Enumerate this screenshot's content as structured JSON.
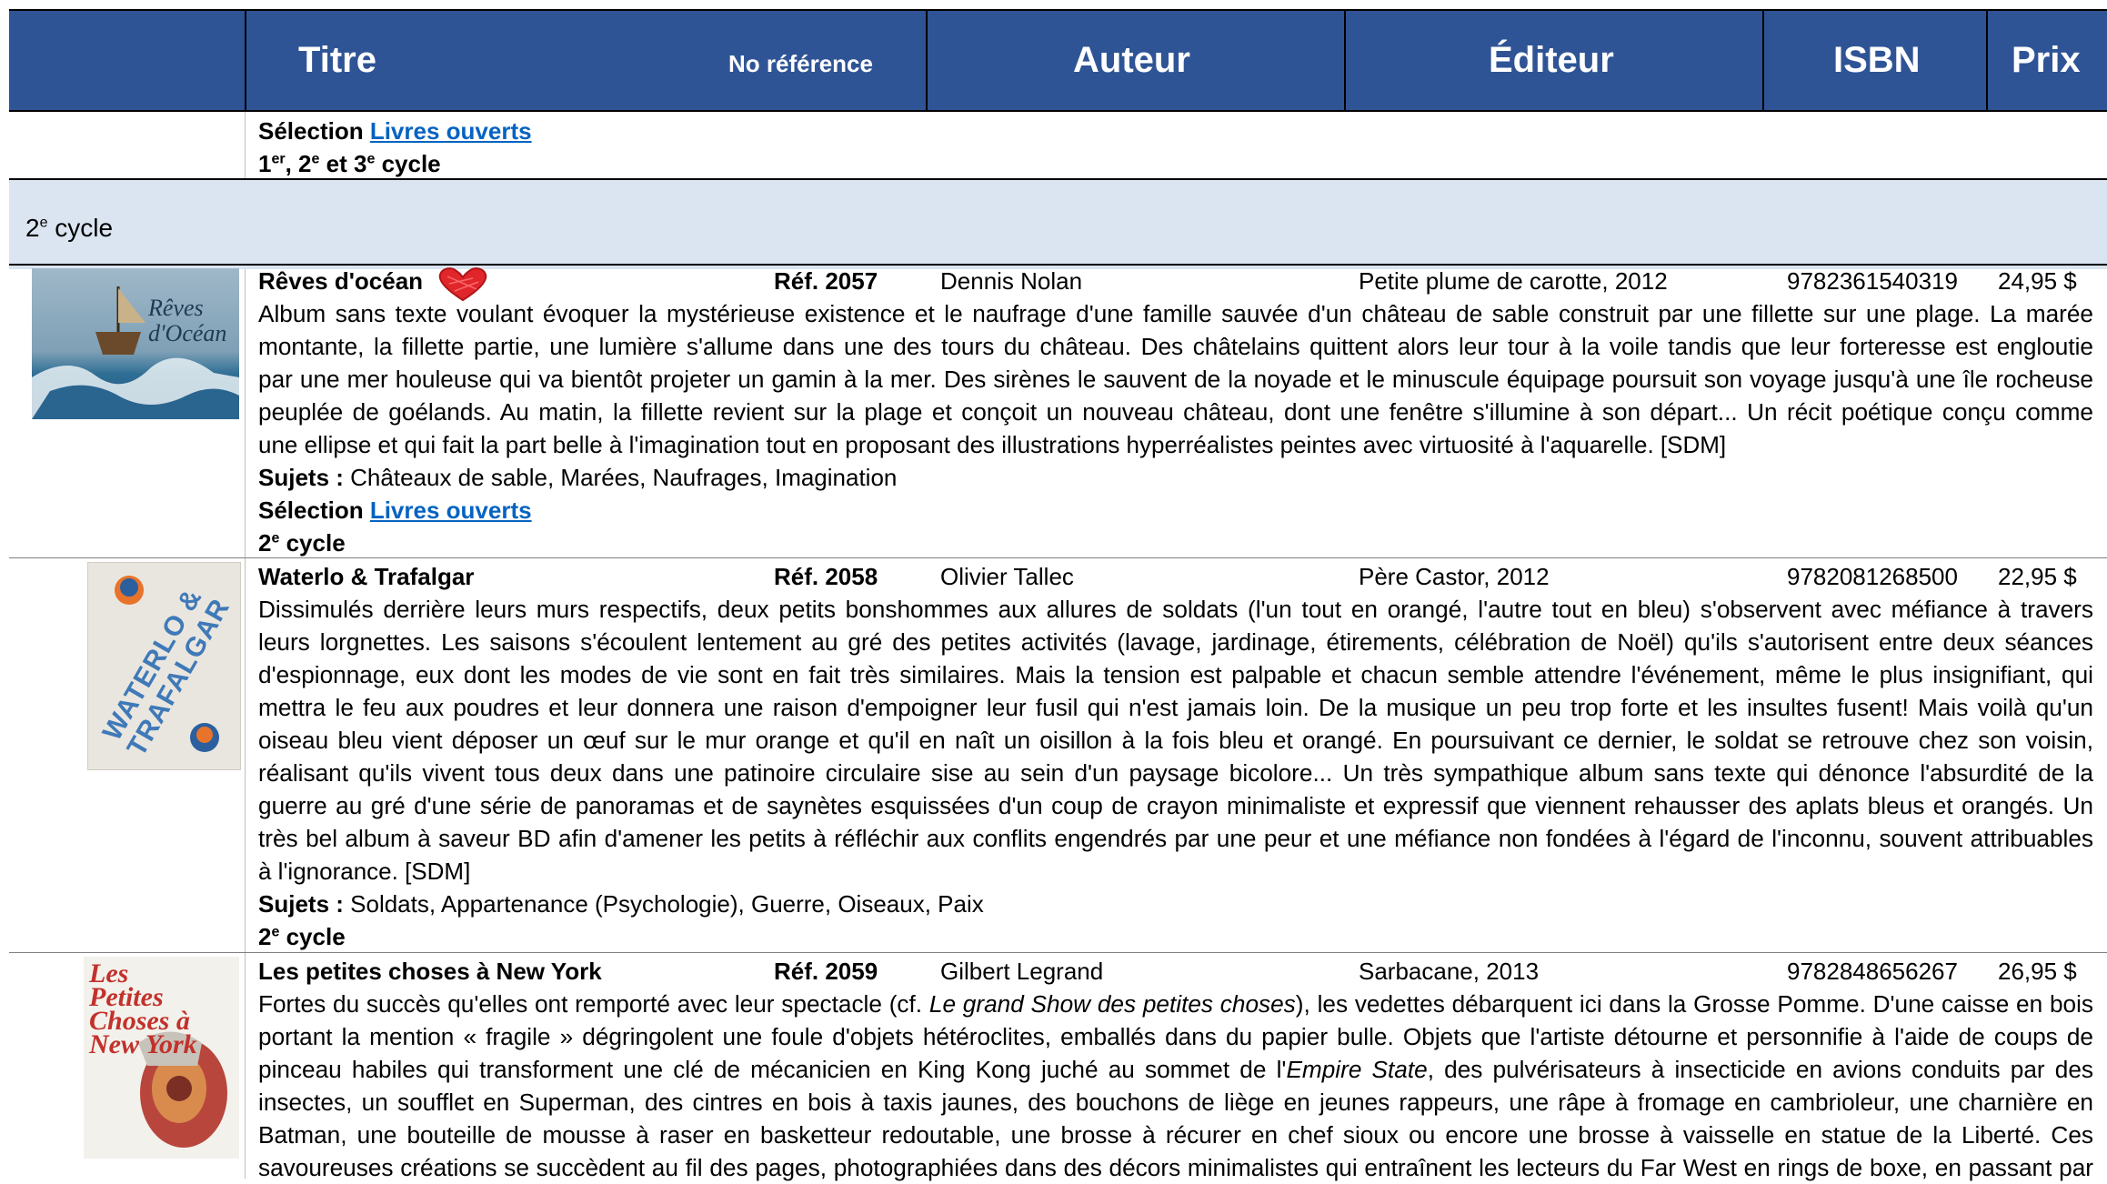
{
  "header": {
    "col_title": "Titre",
    "col_ref": "No référence",
    "col_author": "Auteur",
    "col_publisher": "Éditeur",
    "col_isbn": "ISBN",
    "col_price": "Prix"
  },
  "intro": {
    "selection_label": "Sélection",
    "selection_link": "Livres ouverts",
    "cycles": [
      "1",
      "er",
      ", 2",
      "e",
      " et 3",
      "e",
      " cycle"
    ]
  },
  "section": {
    "num": "2",
    "sup": "e",
    "label": " cycle"
  },
  "books": [
    {
      "title": "Rêves d'océan",
      "ref": "Réf. 2057",
      "author": "Dennis Nolan",
      "publisher": "Petite plume de carotte, 2012",
      "isbn": "9782361540319",
      "price": "24,95 $",
      "cover_title": "Rêves d'Océan",
      "lines": [
        "Album sans texte voulant évoquer la mystérieuse existence et le naufrage d'une famille sauvée d'un château de sable construit par une fillette sur une plage. La marée",
        "montante, la fillette partie, une lumière s'allume dans une des tours du château. Des châtelains quittent alors leur tour à la voile tandis que leur forteresse est engloutie",
        "par une mer houleuse qui va bientôt projeter un gamin à la mer. Des sirènes le sauvent de la noyade et le minuscule équipage poursuit son voyage jusqu'à une île rocheuse",
        "peuplée de goélands. Au matin, la fillette revient sur la plage et conçoit un nouveau château, dont une fenêtre s'illumine à son départ... Un récit poétique conçu comme",
        "une ellipse et qui fait la part belle à l'imagination tout en proposant des illustrations hyperréalistes peintes avec virtuosité à l'aquarelle. [SDM]"
      ],
      "subjects_label": "Sujets :",
      "subjects": " Châteaux de sable, Marées, Naufrages, Imagination",
      "selection_label": "Sélection",
      "selection_link": "Livres ouverts",
      "cycle_num": "2",
      "cycle_sup": "e",
      "cycle_label": " cycle"
    },
    {
      "title": "Waterlo & Trafalgar",
      "ref": "Réf. 2058",
      "author": "Olivier Tallec",
      "publisher": "Père Castor, 2012",
      "isbn": "9782081268500",
      "price": "22,95 $",
      "cover_title": "WATERLO & TRAFALGAR",
      "lines": [
        "Dissimulés derrière leurs murs respectifs, deux petits bonshommes aux allures de soldats (l'un tout en orangé, l'autre tout en bleu) s'observent avec méfiance à travers",
        "leurs lorgnettes. Les saisons s'écoulent lentement au gré des petites activités (lavage, jardinage, étirements, célébration de Noël) qu'ils s'autorisent entre deux séances",
        "d'espionnage, eux dont les modes de vie sont en fait très similaires. Mais la tension est palpable et chacun semble attendre l'événement, même le plus insignifiant, qui",
        "mettra le feu aux poudres et leur donnera une raison d'empoigner leur fusil qui n'est jamais loin. De la musique un peu trop forte et les insultes fusent! Mais voilà qu'un",
        "oiseau bleu vient déposer un œuf sur le mur orange et qu'il en naît un oisillon à la fois bleu et orangé. En poursuivant ce dernier, le soldat se retrouve chez son voisin,",
        "réalisant qu'ils vivent tous deux dans une patinoire circulaire sise au sein d'un paysage bicolore... Un très sympathique album sans texte qui dénonce l'absurdité de la",
        "guerre au gré d'une série de panoramas et de saynètes esquissées d'un coup de crayon minimaliste et expressif que viennent rehausser des aplats bleus et orangés. Un",
        "très bel album à saveur BD afin d'amener les petits à réfléchir aux conflits engendrés par une peur et une méfiance non fondées à l'égard de l'inconnu, souvent attribuables"
      ],
      "last_line": "à l'ignorance. [SDM]",
      "subjects_label": "Sujets :",
      "subjects": " Soldats, Appartenance (Psychologie), Guerre, Oiseaux, Paix",
      "cycle_num": "2",
      "cycle_sup": "e",
      "cycle_label": " cycle"
    },
    {
      "title": "Les petites choses à New York",
      "ref": "Réf. 2059",
      "author": "Gilbert Legrand",
      "publisher": "Sarbacane, 2013",
      "isbn": "9782848656267",
      "price": "26,95 $",
      "cover_title": "Les Petites Choses à New York",
      "line1_a": "Fortes du succès qu'elles ont remporté avec leur spectacle (cf. ",
      "line1_i": "Le grand Show des petites choses",
      "line1_b": "), les vedettes débarquent ici dans la Grosse Pomme. D'une caisse en bois",
      "line2": "portant la mention « fragile » dégringolent une foule d'objets hétéroclites, emballés dans du papier bulle. Objets que l'artiste détourne et personnifie à l'aide de coups de",
      "line3_a": "pinceau habiles qui transforment une clé de mécanicien en King Kong juché au sommet de l'",
      "line3_i": "Empire State",
      "line3_b": ", des pulvérisateurs à insecticide en avions conduits par des",
      "lines_rest": [
        "insectes, un soufflet en Superman, des cintres en bois à taxis jaunes, des bouchons de liège en jeunes rappeurs, une râpe à fromage en cambrioleur, une charnière en",
        "Batman, une bouteille de mousse à raser en basketteur redoutable, une brosse à récurer en chef sioux ou encore une brosse à vaisselle en statue de la Liberté. Ces",
        "savoureuses créations se succèdent au fil des pages, photographiées dans des décors minimalistes qui entraînent les lecteurs du Far West en rings de boxe, en passant par"
      ]
    }
  ],
  "colors": {
    "header_bg": "#2f5496",
    "band_bg": "#dbe5f1",
    "link": "#0563c1",
    "heart": "#e0262b"
  }
}
